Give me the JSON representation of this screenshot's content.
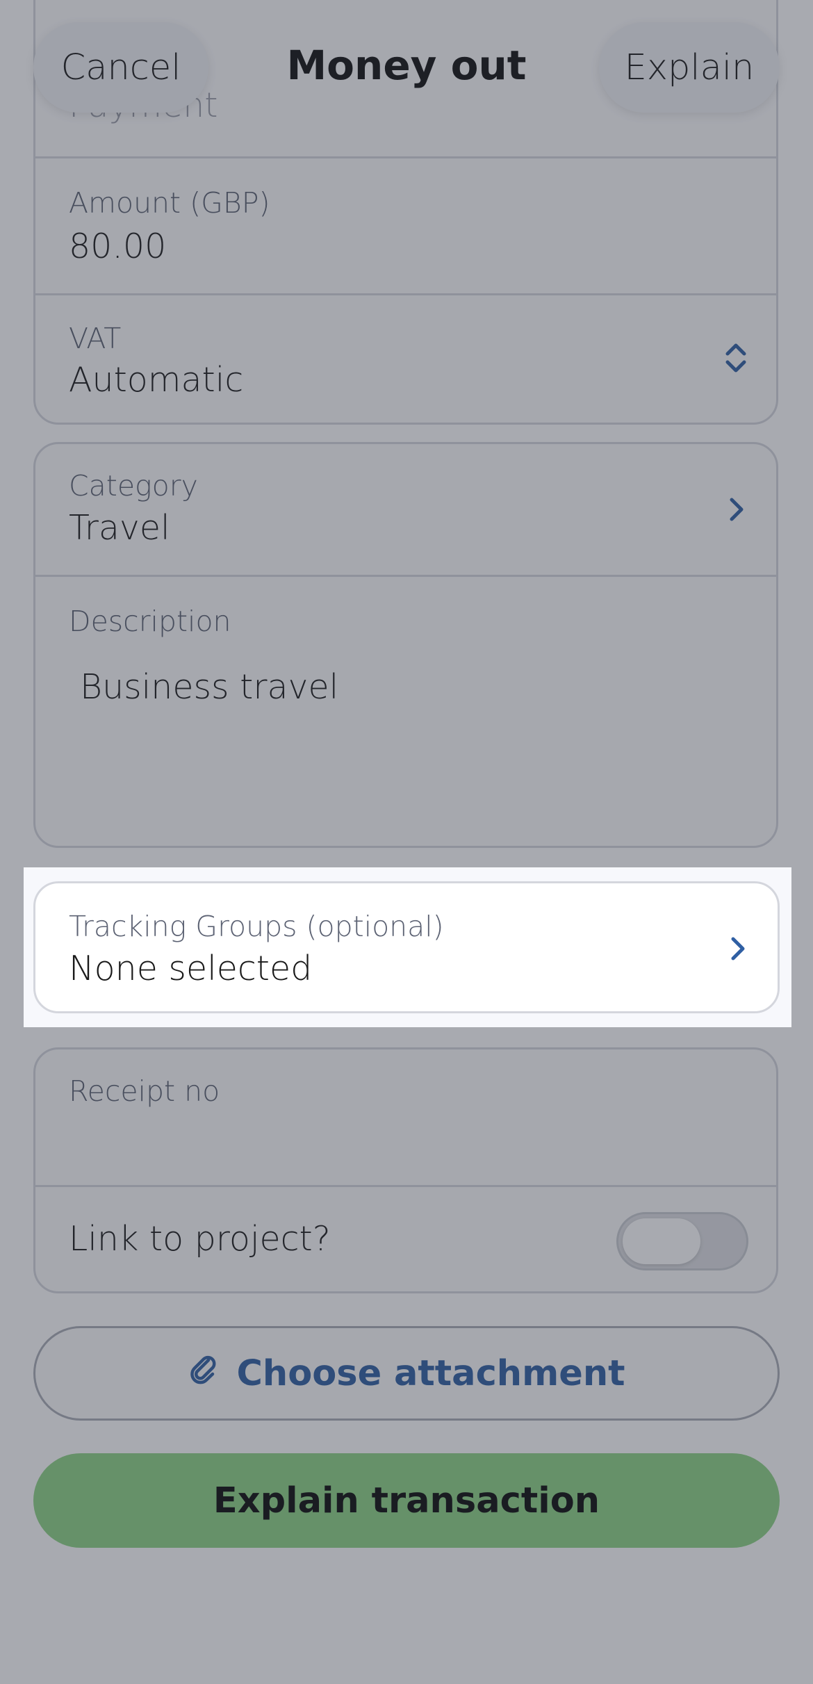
{
  "header": {
    "cancel_label": "Cancel",
    "title": "Money out",
    "explain_label": "Explain"
  },
  "form": {
    "type": {
      "value": "Payment"
    },
    "amount": {
      "label": "Amount (GBP)",
      "value": "80.00"
    },
    "vat": {
      "label": "VAT",
      "value": "Automatic"
    },
    "category": {
      "label": "Category",
      "value": "Travel"
    },
    "description": {
      "label": "Description",
      "value": "Business travel"
    },
    "tracking": {
      "label": "Tracking Groups (optional)",
      "value": "None selected"
    },
    "receipt": {
      "label": "Receipt no",
      "value": ""
    },
    "link_project": {
      "label": "Link to project?",
      "enabled": false
    }
  },
  "actions": {
    "attachment_label": "Choose attachment",
    "explain_transaction_label": "Explain transaction"
  },
  "colors": {
    "accent_blue": "#2f5fa3",
    "primary_green": "#8ed485",
    "overlay": "rgba(48,52,66,0.42)"
  }
}
